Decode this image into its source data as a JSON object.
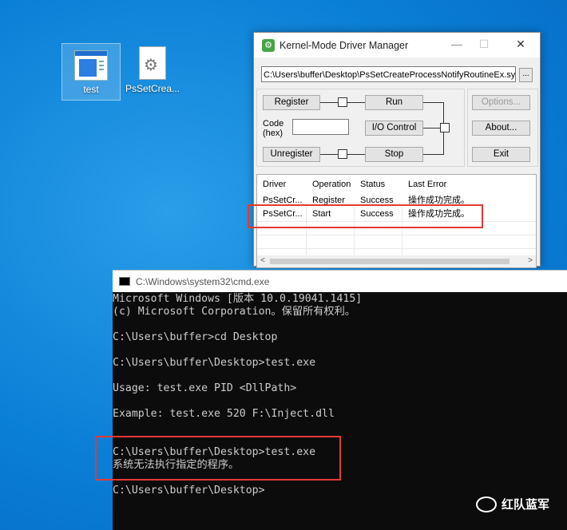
{
  "desktop": {
    "icons": [
      {
        "label": "test",
        "icon": "exe-app-icon"
      },
      {
        "label": "PsSetCrea...",
        "icon": "sys-file-gear-icon"
      }
    ]
  },
  "driver_manager": {
    "title": "Kernel-Mode Driver Manager",
    "title_controls": {
      "minimize": "—",
      "maximize": "☐",
      "close": "✕"
    },
    "driver_path": "C:\\Users\\buffer\\Desktop\\PsSetCreateProcessNotifyRoutineEx.sys",
    "browse_label": "...",
    "buttons": {
      "register": "Register",
      "run": "Run",
      "io_control": "I/O Control",
      "unregister": "Unregister",
      "stop": "Stop",
      "options": "Options...",
      "about": "About...",
      "exit": "Exit"
    },
    "code_label_1": "Code",
    "code_label_2": "(hex)",
    "code_value": "",
    "list": {
      "columns": [
        "Driver",
        "Operation",
        "Status",
        "Last Error"
      ],
      "rows": [
        [
          "PsSetCr...",
          "Register",
          "Success",
          "操作成功完成。"
        ],
        [
          "PsSetCr...",
          "Start",
          "Success",
          "操作成功完成。"
        ]
      ]
    }
  },
  "cmd": {
    "title": "C:\\Windows\\system32\\cmd.exe",
    "lines": [
      "Microsoft Windows [版本 10.0.19041.1415]",
      "(c) Microsoft Corporation。保留所有权利。",
      "",
      "C:\\Users\\buffer>cd Desktop",
      "",
      "C:\\Users\\buffer\\Desktop>test.exe",
      "",
      "Usage: test.exe PID <DllPath>",
      "",
      "Example: test.exe 520 F:\\Inject.dll",
      "",
      "",
      "C:\\Users\\buffer\\Desktop>test.exe",
      "系统无法执行指定的程序。",
      "",
      "C:\\Users\\buffer\\Desktop>"
    ]
  },
  "watermark": {
    "text": "红队蓝军",
    "icon": "wechat-logo-icon"
  },
  "colors": {
    "highlight": "#e53935",
    "desktop": "#0a7fd6",
    "console_bg": "#0c0c0c",
    "console_fg": "#cccccc"
  }
}
